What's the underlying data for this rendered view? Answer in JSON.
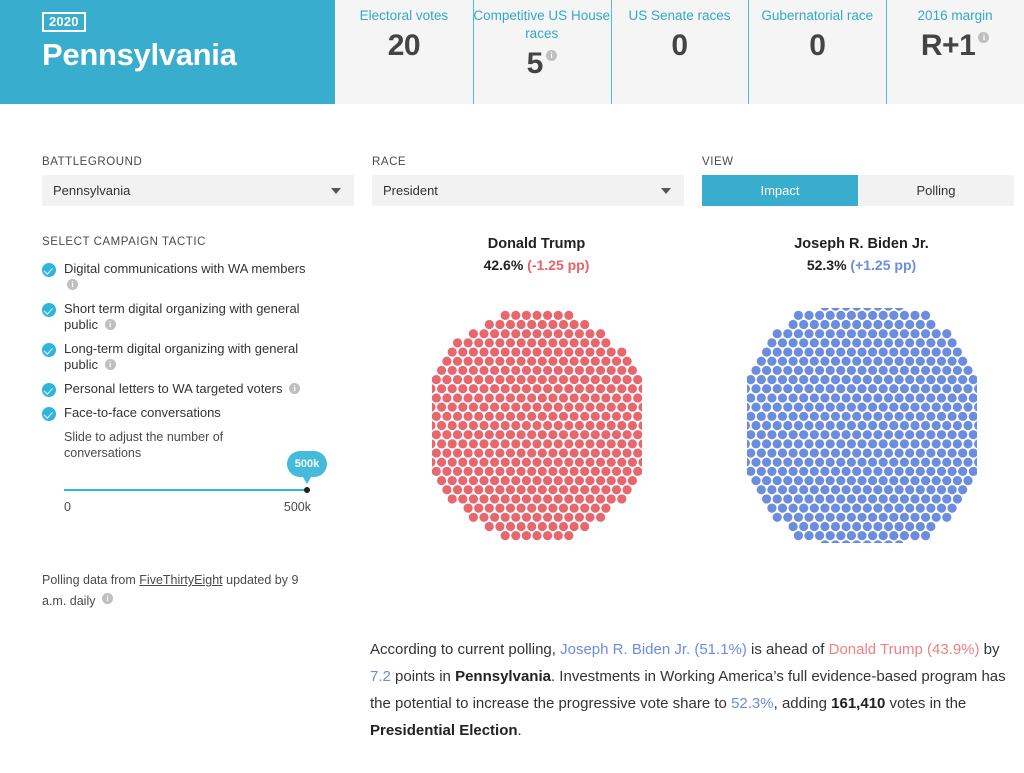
{
  "header": {
    "year_badge": "2020",
    "state": "Pennsylvania",
    "brand_color": "#39ADCD",
    "stats": [
      {
        "label": "Electoral votes",
        "value": "20",
        "info": false
      },
      {
        "label": "Competitive US House races",
        "value": "5",
        "info": true
      },
      {
        "label": "US Senate races",
        "value": "0",
        "info": false
      },
      {
        "label": "Gubernatorial race",
        "value": "0",
        "info": false
      },
      {
        "label": "2016 margin",
        "value": "R+1",
        "info": true
      }
    ]
  },
  "controls": {
    "battleground": {
      "label": "BATTLEGROUND",
      "value": "Pennsylvania"
    },
    "race": {
      "label": "RACE",
      "value": "President"
    },
    "view": {
      "label": "VIEW",
      "options": [
        "Impact",
        "Polling"
      ],
      "selected": "Impact"
    }
  },
  "sidebar": {
    "title": "SELECT CAMPAIGN TACTIC",
    "tactics": [
      {
        "label": "Digital communications with WA members",
        "checked": true,
        "info": true
      },
      {
        "label": "Short term digital organizing with general public",
        "checked": true,
        "info": true
      },
      {
        "label": "Long-term digital organizing with general public",
        "checked": true,
        "info": true
      },
      {
        "label": "Personal letters to WA targeted voters",
        "checked": true,
        "info": true
      },
      {
        "label": "Face-to-face conversations",
        "checked": true,
        "info": false
      }
    ],
    "slider": {
      "help": "Slide to adjust the number of conversations",
      "value_label": "500k",
      "min_label": "0",
      "max_label": "500k"
    },
    "footnote": {
      "prefix": "Polling data from ",
      "link": "FiveThirtyEight",
      "suffix": " updated by 9 a.m. daily"
    }
  },
  "chart_data": {
    "type": "scatter",
    "title": "Projected vote share dot clouds",
    "legend_position": "above-each-cloud",
    "series": [
      {
        "name": "Donald Trump",
        "share_pct": 42.6,
        "share_label": "42.6%",
        "delta_label": "(-1.25 pp)",
        "delta_pp": -1.25,
        "color": "#E8676E",
        "dot_count": 426
      },
      {
        "name": "Joseph R. Biden Jr.",
        "share_pct": 52.3,
        "share_label": "52.3%",
        "delta_label": "(+1.25 pp)",
        "delta_pp": 1.25,
        "color": "#6C8CE0",
        "dot_count": 523
      }
    ]
  },
  "summary": {
    "t1": "According to current polling, ",
    "biden": "Joseph R. Biden Jr. (51.1%)",
    "t2": " is ahead of ",
    "trump": "Donald Trump (43.9%)",
    "t3": " by ",
    "margin": "7.2",
    "t4": " points in ",
    "state": "Pennsylvania",
    "t5": ". Investments in Working America’s full evidence-based program has the potential to increase the progressive vote share to ",
    "new_share": "52.3%",
    "t6": ", adding ",
    "added_votes": "161,410",
    "t7": " votes in the ",
    "election": "Presidential Election",
    "t8": "."
  }
}
